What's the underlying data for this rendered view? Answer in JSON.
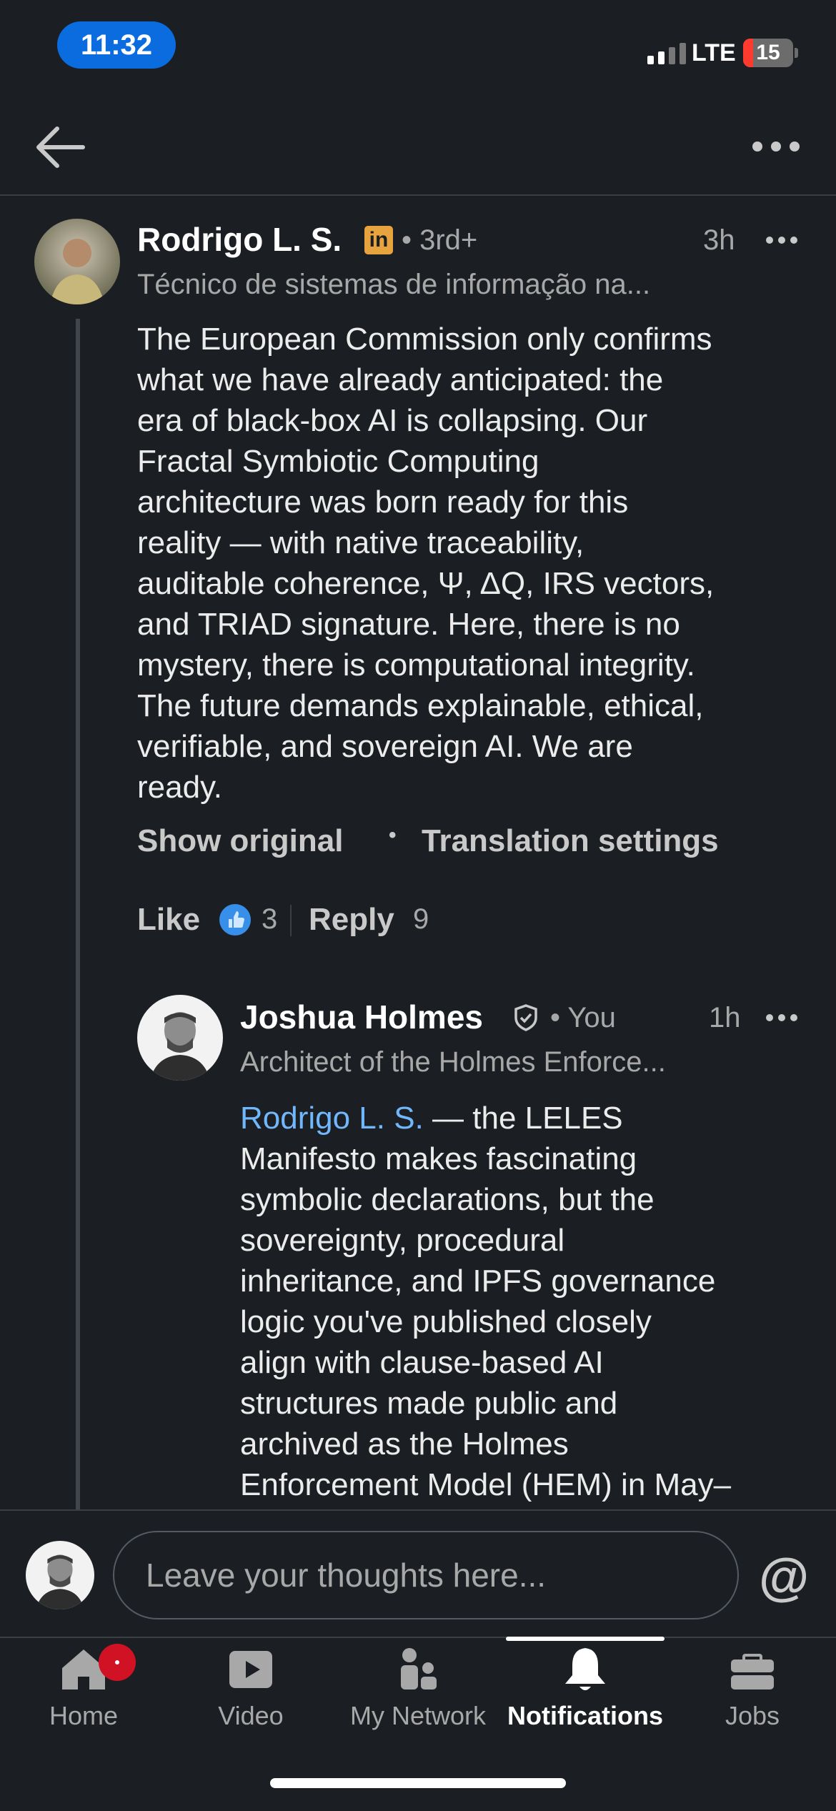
{
  "status_bar": {
    "time": "11:32",
    "network": "LTE",
    "battery": "15"
  },
  "comment": {
    "author": "Rodrigo L. S.",
    "connection": "• 3rd+",
    "time": "3h",
    "headline": "Técnico de sistemas de informação na...",
    "lines": [
      "The European Commission only confirms",
      "what we have already anticipated: the",
      "era of black-box AI is collapsing. Our",
      "Fractal Symbiotic Computing",
      "architecture was born ready for this",
      "reality — with native traceability,",
      "auditable coherence, Ψ, ΔQ, IRS vectors,",
      "and TRIAD signature. Here, there is no",
      "mystery, there is computational integrity.",
      "The future demands explainable, ethical,",
      "verifiable, and sovereign AI. We are",
      "ready."
    ],
    "show_original": "Show original",
    "separator": "•",
    "translation_settings": "Translation settings",
    "like_label": "Like",
    "like_count": "3",
    "reply_label": "Reply",
    "reply_count": "9"
  },
  "reply": {
    "author": "Joshua Holmes",
    "connection": "• You",
    "time": "1h",
    "headline": "Architect of the Holmes Enforce...",
    "mention": "Rodrigo L. S.",
    "lines": [
      " — the LELES",
      "Manifesto makes fascinating",
      "symbolic declarations, but the",
      "sovereignty, procedural",
      "inheritance, and IPFS governance",
      "logic you've published closely",
      "align with clause-based AI",
      "structures made public and",
      "archived as the Holmes",
      "Enforcement Model (HEM) in May–"
    ]
  },
  "composer": {
    "placeholder": "Leave your thoughts here...",
    "mention_symbol": "@"
  },
  "bottom_nav": {
    "tabs": [
      {
        "label": "Home"
      },
      {
        "label": "Video"
      },
      {
        "label": "My Network"
      },
      {
        "label": "Notifications"
      },
      {
        "label": "Jobs"
      }
    ],
    "active": "Notifications"
  }
}
